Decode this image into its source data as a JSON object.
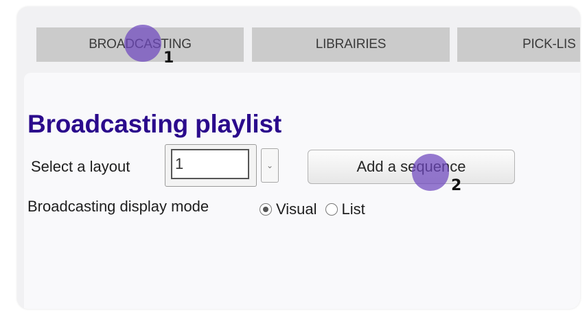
{
  "tabs": [
    {
      "label": "BROADCASTING"
    },
    {
      "label": "LIBRAIRIES"
    },
    {
      "label": "PICK-LIS"
    }
  ],
  "main": {
    "title": "Broadcasting playlist",
    "layout_label": "Select a layout",
    "layout_value": "1",
    "add_button_label": "Add a sequence",
    "mode_label": "Broadcasting display mode",
    "mode_options": [
      {
        "label": "Visual",
        "selected": true
      },
      {
        "label": "List",
        "selected": false
      }
    ]
  },
  "markers": [
    {
      "number": "1"
    },
    {
      "number": "2"
    }
  ],
  "colors": {
    "title": "#2b0a8c",
    "marker": "#6e46be",
    "tab_bg": "#cbcbcb"
  }
}
